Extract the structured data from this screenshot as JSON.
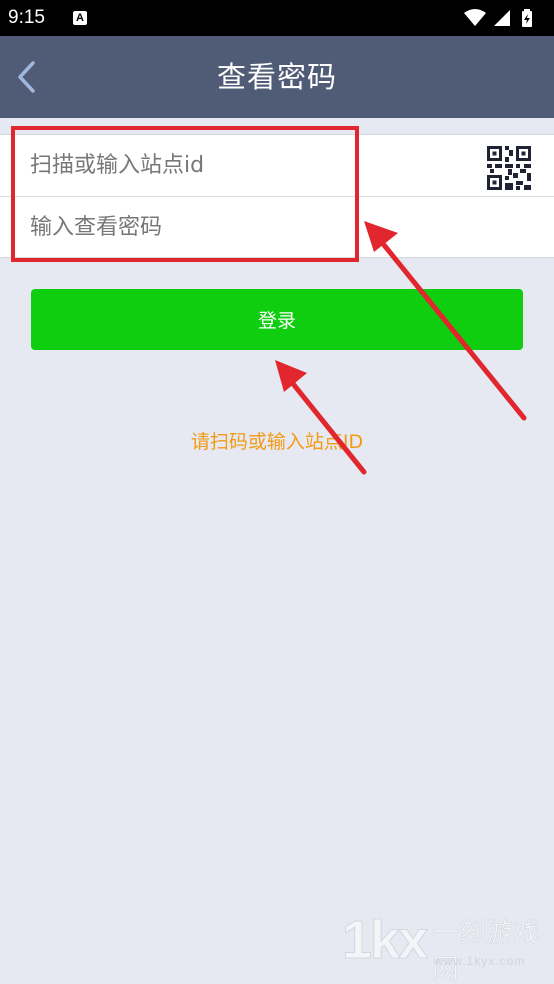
{
  "status_bar": {
    "time": "9:15",
    "notification_icon_letter": "A",
    "icons": [
      "wifi-icon",
      "signal-icon",
      "battery-icon"
    ]
  },
  "header": {
    "title": "查看密码",
    "back_icon": "chevron-left-icon"
  },
  "form": {
    "site_id_placeholder": "扫描或输入站点id",
    "site_id_value": "",
    "password_placeholder": "输入查看密码",
    "password_value": "",
    "qr_icon": "qr-code-icon"
  },
  "login_button": {
    "label": "登录"
  },
  "hint": "请扫码或输入站点ID",
  "watermark": {
    "logo": "1kx",
    "name": "一刻游戏网",
    "url": "www.1kyx.com"
  },
  "colors": {
    "header_bg": "#505b76",
    "page_bg": "#e6e9f1",
    "login_green": "#0fce10",
    "hint_orange": "#f39a14",
    "annotation_red": "#e1262d"
  }
}
